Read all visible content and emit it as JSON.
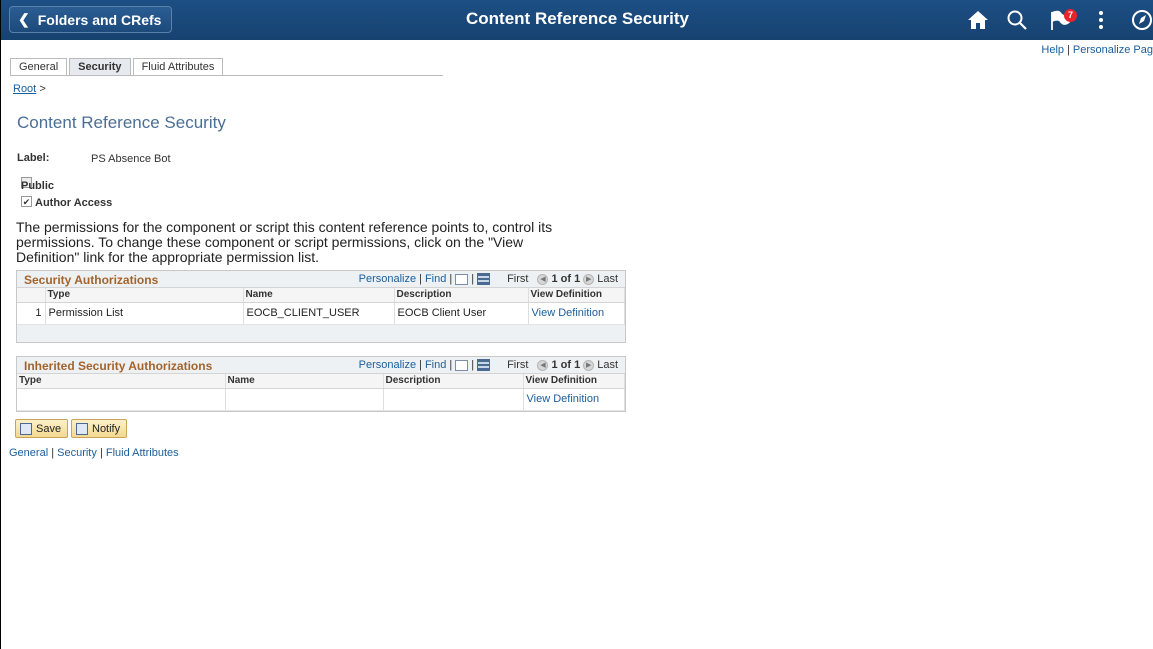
{
  "banner": {
    "back_label": "Folders and CRefs",
    "title": "Content Reference Security",
    "notification_count": "7"
  },
  "top_links": {
    "help": "Help",
    "sep": "|",
    "personalize": "Personalize Pag"
  },
  "tabs": [
    {
      "label": "General"
    },
    {
      "label": "Security"
    },
    {
      "label": "Fluid Attributes"
    }
  ],
  "breadcrumb": {
    "root": "Root",
    "arrow": ">"
  },
  "page_title": "Content Reference Security",
  "label_field": {
    "label": "Label:",
    "value": "PS Absence Bot"
  },
  "checkboxes": {
    "public": {
      "label": "Public",
      "checked": false
    },
    "author_access": {
      "label": "Author Access",
      "checked": true
    }
  },
  "paragraph": "The permissions for the component or script this content reference points to, control its permissions. To change these component or script permissions, click on the \"View Definition\" link for the appropriate permission list.",
  "security_grid": {
    "title": "Security Authorizations",
    "nav": {
      "personalize": "Personalize",
      "find": "Find",
      "first": "First",
      "position": "1 of 1",
      "last": "Last"
    },
    "columns": [
      "Type",
      "Name",
      "Description",
      "View Definition"
    ],
    "rows": [
      {
        "num": "1",
        "type": "Permission List",
        "name": "EOCB_CLIENT_USER",
        "description": "EOCB Client User",
        "link": "View Definition"
      }
    ]
  },
  "inherited_grid": {
    "title": "Inherited Security Authorizations",
    "nav": {
      "personalize": "Personalize",
      "find": "Find",
      "first": "First",
      "position": "1 of 1",
      "last": "Last"
    },
    "columns": [
      "Type",
      "Name",
      "Description",
      "View Definition"
    ],
    "rows": [
      {
        "type": "",
        "name": "",
        "description": "",
        "link": "View Definition"
      }
    ]
  },
  "buttons": {
    "save": "Save",
    "notify": "Notify"
  },
  "bottom_links": [
    "General",
    "Security",
    "Fluid Attributes"
  ],
  "colors": {
    "banner": "#1d4f85",
    "link": "#1b5e9b",
    "grid_title": "#a3642b",
    "page_title": "#4b6e96"
  }
}
